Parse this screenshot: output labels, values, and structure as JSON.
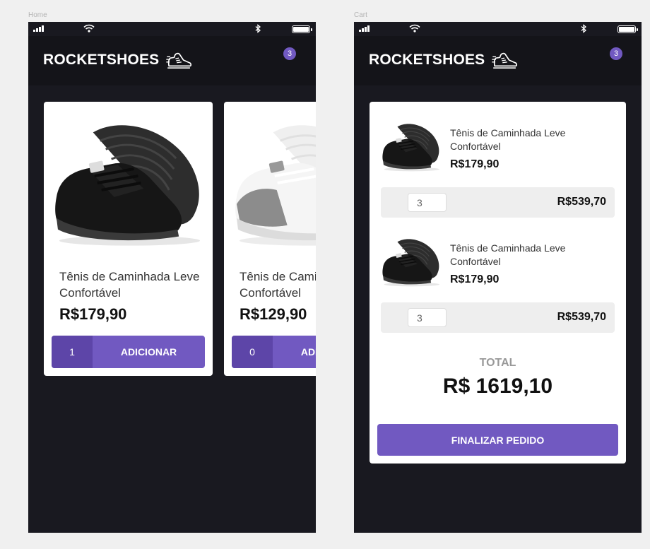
{
  "frames": {
    "home_label": "Home",
    "cart_label": "Cart"
  },
  "brand": {
    "name": "ROCKETSHOES",
    "accent": "#7159c1",
    "background": "#191920"
  },
  "header": {
    "cart_count": "3"
  },
  "home": {
    "products": [
      {
        "title": "Tênis de Caminhada Leve Confortável",
        "price": "R$179,90",
        "amount": "1",
        "button_label": "ADICIONAR",
        "shoe_color": "black"
      },
      {
        "title": "Tênis de Caminhada Leve Confortável",
        "price": "R$129,90",
        "amount": "0",
        "button_label": "ADICIONAR",
        "shoe_color": "white-grey"
      }
    ]
  },
  "cart": {
    "items": [
      {
        "title": "Tênis de Caminhada Leve Confortável",
        "price": "R$179,90",
        "quantity": "3",
        "subtotal": "R$539,70"
      },
      {
        "title": "Tênis de Caminhada Leve Confortável",
        "price": "R$179,90",
        "quantity": "3",
        "subtotal": "R$539,70"
      }
    ],
    "total_label": "TOTAL",
    "total_value": "R$ 1619,10",
    "checkout_label": "FINALIZAR PEDIDO"
  }
}
